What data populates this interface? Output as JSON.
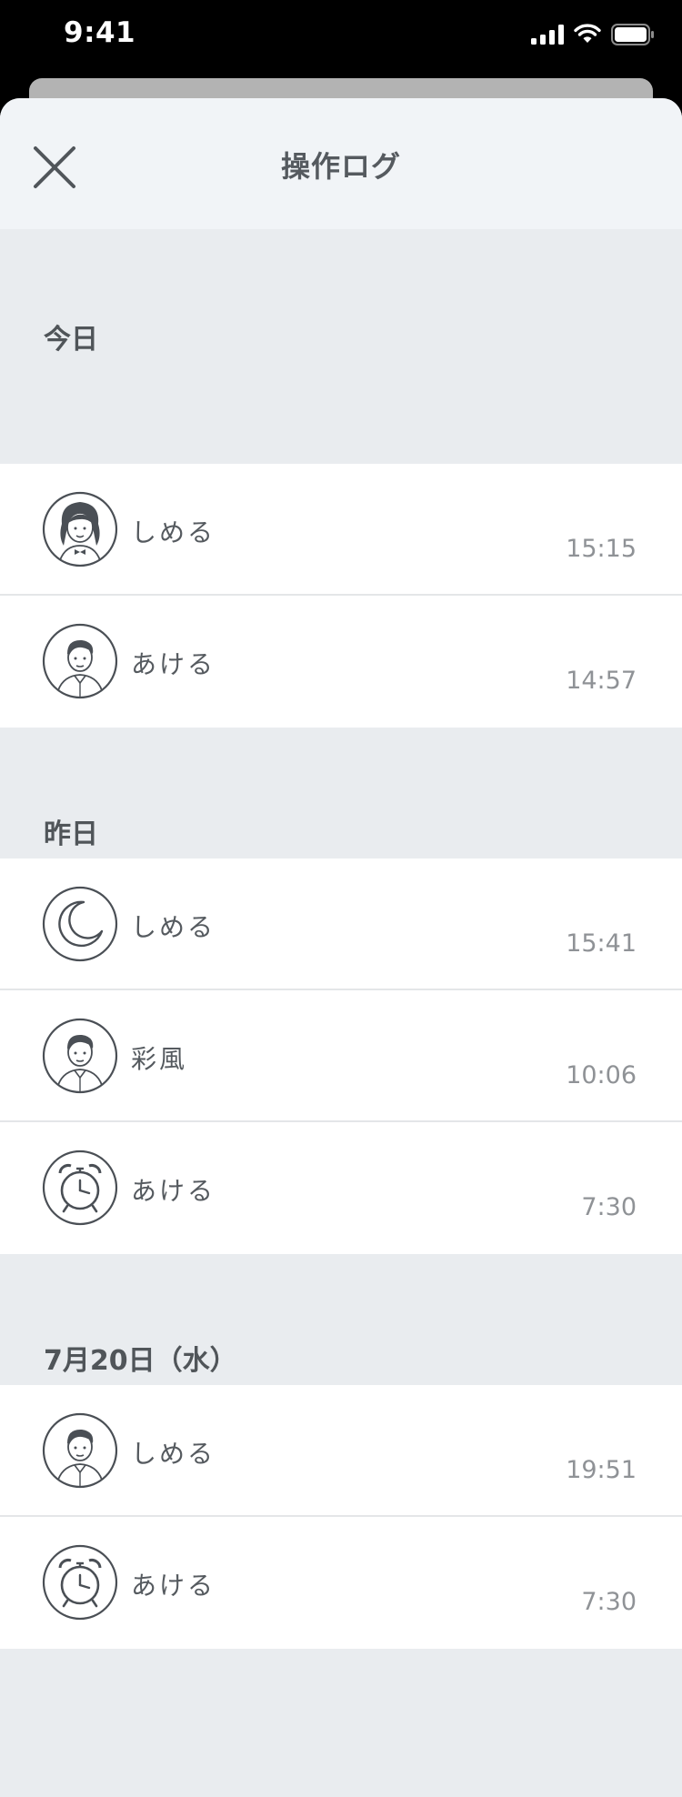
{
  "status_bar": {
    "time": "9:41"
  },
  "header": {
    "title": "操作ログ",
    "close_icon": "close-icon"
  },
  "sections": [
    {
      "label": "今日",
      "rows": [
        {
          "icon": "woman-avatar-icon",
          "action": "しめる",
          "time": "15:15"
        },
        {
          "icon": "man-avatar-icon",
          "action": "あける",
          "time": "14:57"
        }
      ]
    },
    {
      "label": "昨日",
      "rows": [
        {
          "icon": "moon-icon",
          "action": "しめる",
          "time": "15:41"
        },
        {
          "icon": "man-avatar-icon",
          "action": "彩風",
          "time": "10:06"
        },
        {
          "icon": "alarm-clock-icon",
          "action": "あける",
          "time": "7:30"
        }
      ]
    },
    {
      "label": "7月20日（水）",
      "rows": [
        {
          "icon": "man-avatar-icon",
          "action": "しめる",
          "time": "19:51"
        },
        {
          "icon": "alarm-clock-icon",
          "action": "あける",
          "time": "7:30"
        }
      ]
    }
  ],
  "colors": {
    "sheet_background": "#e9ecef",
    "header_background": "#f1f4f7",
    "row_background": "#ffffff",
    "text_primary": "#555a5f",
    "text_time": "#8f9296"
  }
}
